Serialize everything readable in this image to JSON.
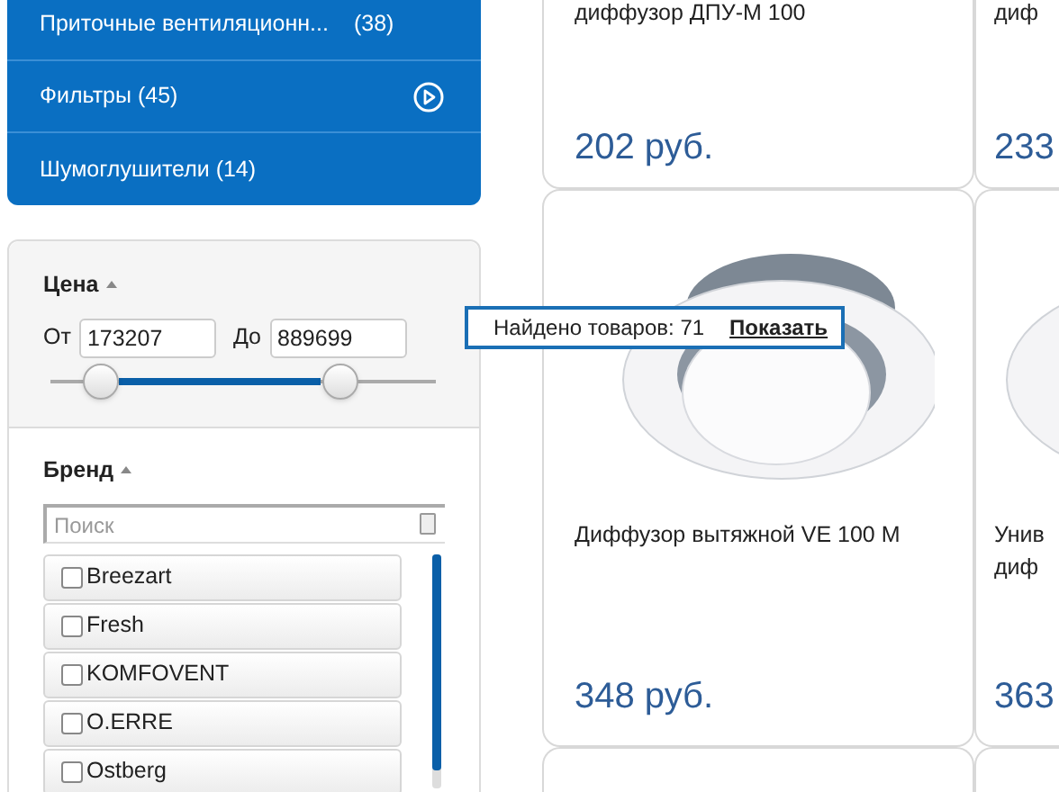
{
  "categories": [
    {
      "label": "Приточные вентиляционн...",
      "count": "(38)",
      "has_arrow": false
    },
    {
      "label": "Фильтры (45)",
      "has_arrow": true
    },
    {
      "label": "Шумоглушители (14)",
      "has_arrow": false
    }
  ],
  "price_filter": {
    "title": "Цена",
    "expanded": true,
    "from_label": "От",
    "from_value": "173207",
    "to_label": "До",
    "to_value": "889699",
    "thumbs": [
      {
        "level": 0.13
      },
      {
        "level": 0.75
      }
    ]
  },
  "tooltip": {
    "text": "Найдено товаров: 71",
    "link": "Показать"
  },
  "brand_filter": {
    "title": "Бренд",
    "expanded": true,
    "search_placeholder": "Поиск",
    "brands": [
      {
        "label": "Breezart",
        "checked": false
      },
      {
        "label": "Fresh",
        "checked": false
      },
      {
        "label": "KOMFOVENT",
        "checked": false
      },
      {
        "label": "O.ERRE",
        "checked": false
      },
      {
        "label": "Ostberg",
        "checked": false
      }
    ]
  },
  "product_rows": [
    [
      {
        "title": "диффузор ДПУ-М 100",
        "price": "202 руб.",
        "image": false
      },
      {
        "title": "диф",
        "price": "233",
        "image": false
      }
    ],
    [
      {
        "title": "Диффузор вытяжной VE 100 M",
        "price": "348 руб.",
        "image": true
      },
      {
        "title": "Унив диф",
        "price": "363",
        "image": true
      }
    ]
  ]
}
